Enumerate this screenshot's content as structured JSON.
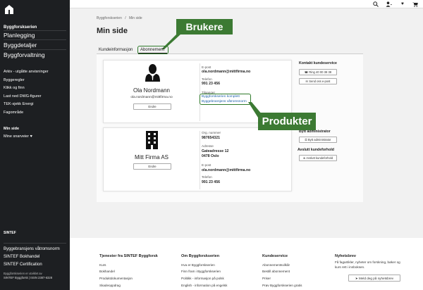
{
  "sidebar": {
    "title": "Byggforskserien",
    "main_items": [
      "Planlegging",
      "Byggdetaljer",
      "Byggforvaltning"
    ],
    "sub_items": [
      "Arkiv - utgåtte anvisninger",
      "Byggeregler",
      "Klikk og finn",
      "Last ned DWG-figurer",
      "TEK-sjekk Energi",
      "Fagområde"
    ],
    "min_side": "Min side",
    "favorites": "Mine snarveier ♥",
    "brand": "SINTEF",
    "footer_links": [
      "Byggebransjens våtromsnorm",
      "SINTEF Bokhandel",
      "SINTEF Certification"
    ],
    "small_1": "Byggforskserien er utviklet av",
    "small_2": "SINTEF Byggforsk  | ISSN 2387-6328"
  },
  "breadcrumb": {
    "home": "Byggforskserien",
    "sep": "/",
    "current": "Min side"
  },
  "page_title": "Min side",
  "tabs": {
    "kunde": "Kundeinformasjon",
    "abonnement": "Abonnement"
  },
  "callouts": {
    "brukere": "Brukere",
    "produkter": "Produkter"
  },
  "user_card": {
    "name": "Ola Nordmann",
    "email": "ola.nordmann@mittfirma.no",
    "edit": "Endre",
    "epost_label": "E-post",
    "epost_value": "ola.nordmann@mittfirma.no",
    "telefon_label": "Telefon",
    "telefon_value": "991 23 456",
    "tilganger_label": "Tilganger",
    "tilganger": [
      "Byggforskserien komplett",
      "Byggebransjens våtromsnorm"
    ]
  },
  "company_card": {
    "name": "Mitt Firma AS",
    "edit": "Endre",
    "org_label": "Org. nummer",
    "org_value": "987654321",
    "adresse_label": "Adresse",
    "adresse_line1": "Gateadresse 12",
    "adresse_line2": "0478 Oslo",
    "epost_label": "E-post",
    "epost_value": "ola.nordmann@mittfirma.no",
    "telefon_label": "Telefon",
    "telefon_value": "991 23 456"
  },
  "service": {
    "kontakt_heading": "Kontakt kundeservice",
    "ring_button": "Ring 40 00 38 38",
    "send_button": "Send oss e-post",
    "admin_heading": "Bytt administrator",
    "admin_button": "Bytt administrator",
    "avslutt_heading": "Avslutt kundeforhold",
    "avslutt_button": "Avslutt kundeforhold"
  },
  "footer": {
    "col1": {
      "heading": "Tjenester fra SINTEF Byggforsk",
      "links": [
        "Kurs",
        "Bokhandel",
        "Produktdokumentasjon",
        "Skadeoppdrag"
      ]
    },
    "col2": {
      "heading": "Om Byggforskserien",
      "links": [
        "Hva er Byggforskserien",
        "Finn fram i Byggforskserien",
        "Politikk - informasjon på polsk",
        "English - information på engelsk"
      ]
    },
    "col3": {
      "heading": "Kundeservice",
      "links": [
        "Abonnementsvilkår",
        "Bestill abonnement",
        "Priser",
        "Prøv Byggforskserien gratis"
      ]
    },
    "col4": {
      "heading": "Nyhetsbrev",
      "text_1": "Få fagartikler, nyheter om forskning, bøker og",
      "text_2": "kurs rett i innboksen.",
      "button": "Meld deg på nyhetsbrev"
    }
  },
  "colors": {
    "sidebar_bg": "#1d1f22",
    "callout_green": "#3c7a33",
    "link_blue": "#1a5fa8"
  }
}
